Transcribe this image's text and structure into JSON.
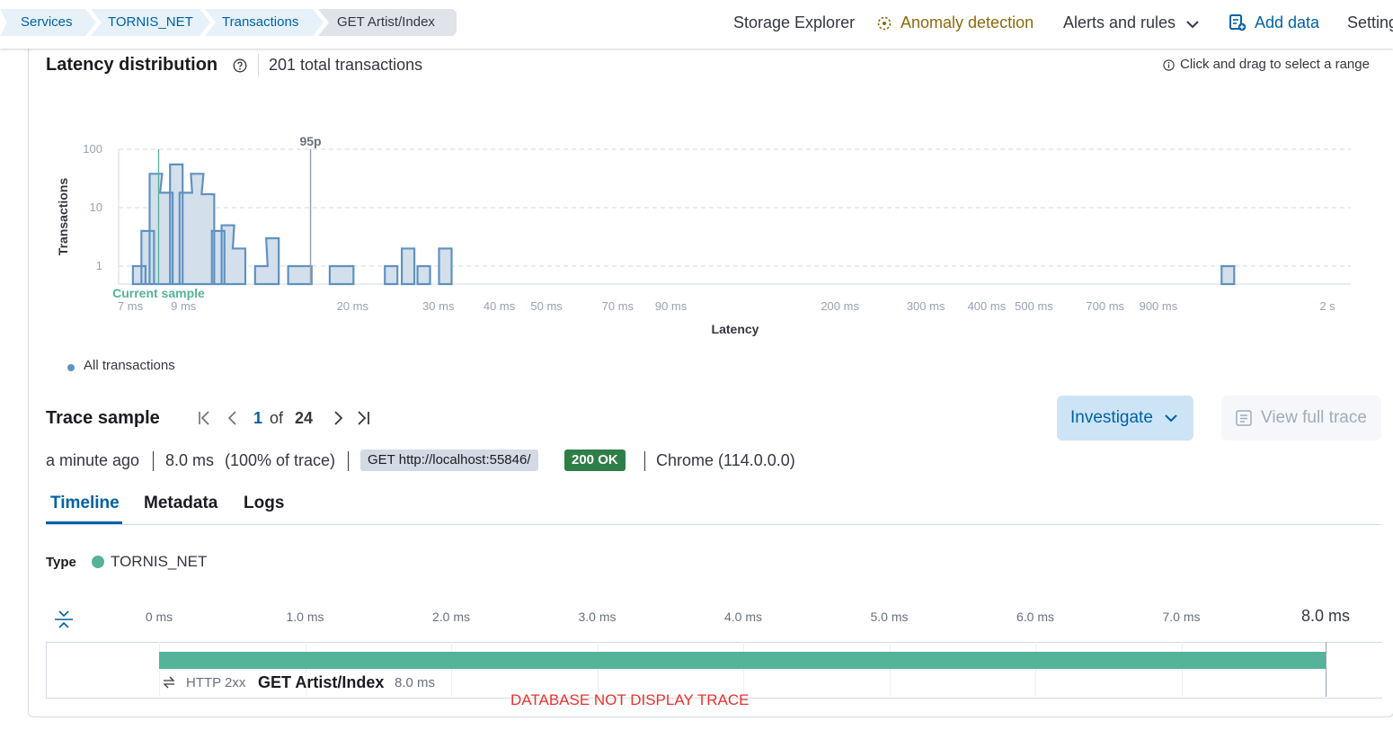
{
  "breadcrumbs": [
    "Services",
    "TORNIS_NET",
    "Transactions",
    "GET Artist/Index"
  ],
  "topnav": {
    "storage_explorer": "Storage Explorer",
    "anomaly_detection": "Anomaly detection",
    "alerts_and_rules": "Alerts and rules",
    "add_data": "Add data",
    "settings": "Settings"
  },
  "latency": {
    "title": "Latency distribution",
    "total": "201 total transactions",
    "hint": "Click and drag to select a range",
    "percentile_label": "95p",
    "current_sample_label": "Current sample",
    "legend": "All transactions"
  },
  "chart_data": {
    "type": "area",
    "xlabel": "Latency",
    "ylabel": "Transactions",
    "y_scale": "log",
    "y_ticks": [
      "100",
      "10",
      "1"
    ],
    "x_ticks": [
      "7 ms",
      "9 ms",
      "20 ms",
      "30 ms",
      "40 ms",
      "50 ms",
      "70 ms",
      "90 ms",
      "200 ms",
      "300 ms",
      "400 ms",
      "500 ms",
      "700 ms",
      "900 ms",
      "2 s"
    ],
    "series": [
      {
        "name": "All transactions",
        "bins": [
          {
            "latency_ms": 7.3,
            "count": 1
          },
          {
            "latency_ms": 7.6,
            "count": 4
          },
          {
            "latency_ms": 7.9,
            "count": 38
          },
          {
            "latency_ms": 8.3,
            "count": 18
          },
          {
            "latency_ms": 8.7,
            "count": 55
          },
          {
            "latency_ms": 9.1,
            "count": 18
          },
          {
            "latency_ms": 9.6,
            "count": 38
          },
          {
            "latency_ms": 10.1,
            "count": 17
          },
          {
            "latency_ms": 10.6,
            "count": 4
          },
          {
            "latency_ms": 11.1,
            "count": 5
          },
          {
            "latency_ms": 11.7,
            "count": 2
          },
          {
            "latency_ms": 13.0,
            "count": 1
          },
          {
            "latency_ms": 13.7,
            "count": 3
          },
          {
            "latency_ms": 15.2,
            "count": 1
          },
          {
            "latency_ms": 16.0,
            "count": 1
          },
          {
            "latency_ms": 18.5,
            "count": 1
          },
          {
            "latency_ms": 19.5,
            "count": 1
          },
          {
            "latency_ms": 24.0,
            "count": 1
          },
          {
            "latency_ms": 26.0,
            "count": 2
          },
          {
            "latency_ms": 28.0,
            "count": 1
          },
          {
            "latency_ms": 31.0,
            "count": 2
          },
          {
            "latency_ms": 1250,
            "count": 1
          }
        ]
      }
    ],
    "percentile_95_ms": 16.4,
    "current_sample_ms": 8.0
  },
  "trace": {
    "title": "Trace sample",
    "page": "1",
    "of": "of",
    "total": "24",
    "investigate": "Investigate",
    "view_full_trace": "View full trace",
    "time_ago": "a minute ago",
    "duration": "8.0 ms",
    "percent": "(100% of trace)",
    "request": "GET http://localhost:55846/",
    "status": "200 OK",
    "agent": "Chrome (114.0.0.0)"
  },
  "tabs": [
    "Timeline",
    "Metadata",
    "Logs"
  ],
  "timeline": {
    "type_label": "Type",
    "type_value": "TORNIS_NET",
    "type_color": "#54b399",
    "ticks": [
      "0 ms",
      "1.0 ms",
      "2.0 ms",
      "3.0 ms",
      "4.0 ms",
      "5.0 ms",
      "6.0 ms",
      "7.0 ms"
    ],
    "end_tick": "8.0 ms",
    "span": {
      "icon": "exchange-icon",
      "status": "HTTP 2xx",
      "name": "GET Artist/Index",
      "duration": "8.0 ms"
    },
    "annotation": "DATABASE NOT DISPLAY TRACE"
  },
  "colors": {
    "link": "#0061a6",
    "anomaly": "#8a6a0a",
    "histogram_fill": "#cfdcea",
    "histogram_stroke": "#6092c0",
    "current_sample": "#54b399",
    "status_green": "#2f7d47",
    "annotation_red": "#e7332d"
  }
}
